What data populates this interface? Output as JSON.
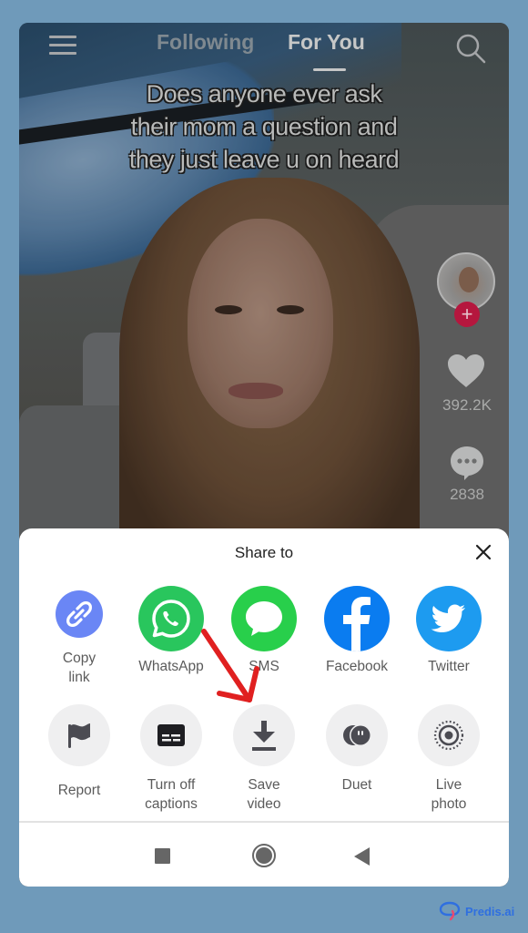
{
  "top_nav": {
    "tabs": [
      {
        "label": "Following",
        "active": false
      },
      {
        "label": "For You",
        "active": true
      }
    ],
    "menu_icon": "hamburger-menu-icon",
    "search_icon": "search-icon"
  },
  "video": {
    "caption_lines": [
      "Does anyone ever ask",
      "their mom a question and",
      "they just leave u on heard"
    ],
    "likes": "392.2K",
    "comments": "2838",
    "follow_symbol": "+"
  },
  "share_sheet": {
    "title": "Share to",
    "close_icon": "close-icon",
    "share_targets": [
      {
        "label_lines": [
          "Copy",
          "link"
        ],
        "icon": "link-icon",
        "color": "#6a86f5"
      },
      {
        "label_lines": [
          "WhatsApp"
        ],
        "icon": "whatsapp-icon",
        "color": "#25d366"
      },
      {
        "label_lines": [
          "SMS"
        ],
        "icon": "sms-bubble-icon",
        "color": "#26d24a"
      },
      {
        "label_lines": [
          "Facebook"
        ],
        "icon": "facebook-icon",
        "color": "#0a7cf0"
      },
      {
        "label_lines": [
          "Twitter"
        ],
        "icon": "twitter-bird-icon",
        "color": "#1da1f2"
      }
    ],
    "actions": [
      {
        "label_lines": [
          "Report"
        ],
        "icon": "flag-icon"
      },
      {
        "label_lines": [
          "Turn off",
          "captions"
        ],
        "icon": "captions-icon"
      },
      {
        "label_lines": [
          "Save",
          "video"
        ],
        "icon": "download-icon"
      },
      {
        "label_lines": [
          "Duet"
        ],
        "icon": "duet-icon"
      },
      {
        "label_lines": [
          "Live",
          "photo"
        ],
        "icon": "live-photo-icon"
      }
    ]
  },
  "system_nav": {
    "recents": "recents-square-icon",
    "home": "home-circle-icon",
    "back": "back-triangle-icon"
  },
  "annotation": {
    "arrow_color": "#e02020",
    "points_to": "Save video"
  },
  "watermark": {
    "brand": "Predis.ai"
  },
  "colors": {
    "page_background": "#6f9aba",
    "like_follow_red": "#b5173e"
  }
}
